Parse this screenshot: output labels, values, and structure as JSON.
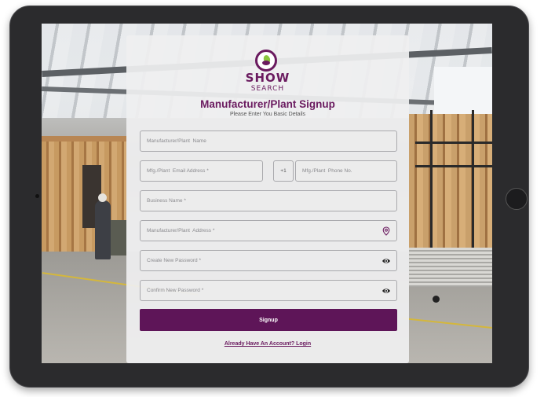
{
  "brand": {
    "logo_top": "SHOW",
    "logo_bottom": "SEARCH",
    "accent_color": "#6a1a5f",
    "leaf_color": "#8bc53f"
  },
  "form": {
    "title": "Manufacturer/Plant Signup",
    "subtitle": "Please Enter You Basic Details",
    "fields": {
      "plant_name": {
        "placeholder": "Manufacturer/Plant  Name",
        "value": ""
      },
      "email": {
        "placeholder": "Mfg./Plant  Email Address *",
        "value": ""
      },
      "country_code": "+1",
      "phone": {
        "placeholder": "Mfg./Plant  Phone No.",
        "value": ""
      },
      "business_name": {
        "placeholder": "Business Name *",
        "value": ""
      },
      "address": {
        "placeholder": "Manufacturer/Plant  Address *",
        "value": "",
        "icon": "location-pin-icon"
      },
      "password": {
        "placeholder": "Create New Password *",
        "value": "",
        "icon": "eye-icon"
      },
      "confirm_password": {
        "placeholder": "Confirm New Password *",
        "value": "",
        "icon": "eye-icon"
      }
    },
    "submit_label": "Signup",
    "login_link": "Already Have An Account? Login"
  }
}
